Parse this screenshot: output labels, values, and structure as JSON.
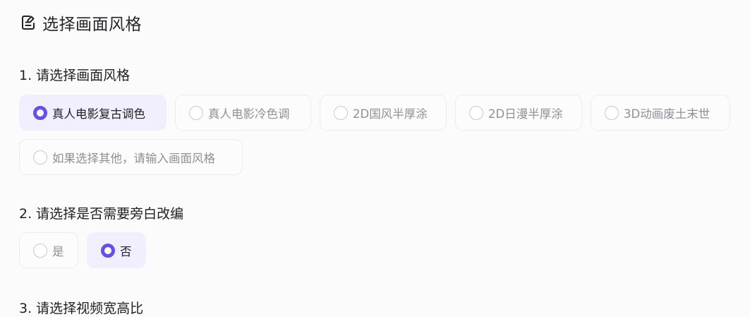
{
  "header": {
    "title": "选择画面风格",
    "icon": "edit-note-icon"
  },
  "questions": [
    {
      "title": "1. 请选择画面风格",
      "options": [
        {
          "label": "真人电影复古调色",
          "selected": true
        },
        {
          "label": "真人电影冷色调",
          "selected": false
        },
        {
          "label": "2D国风半厚涂",
          "selected": false
        },
        {
          "label": "2D日漫半厚涂",
          "selected": false
        },
        {
          "label": "3D动画废土末世",
          "selected": false
        },
        {
          "label": "如果选择其他，请输入画面风格",
          "selected": false
        }
      ]
    },
    {
      "title": "2. 请选择是否需要旁白改编",
      "options": [
        {
          "label": "是",
          "selected": false
        },
        {
          "label": "否",
          "selected": true
        }
      ]
    },
    {
      "title": "3. 请选择视频宽高比",
      "options": []
    }
  ],
  "colors": {
    "accent": "#6a4fe0",
    "selected_bg": "#f1eefe",
    "unselected_text": "#8f8f96"
  }
}
